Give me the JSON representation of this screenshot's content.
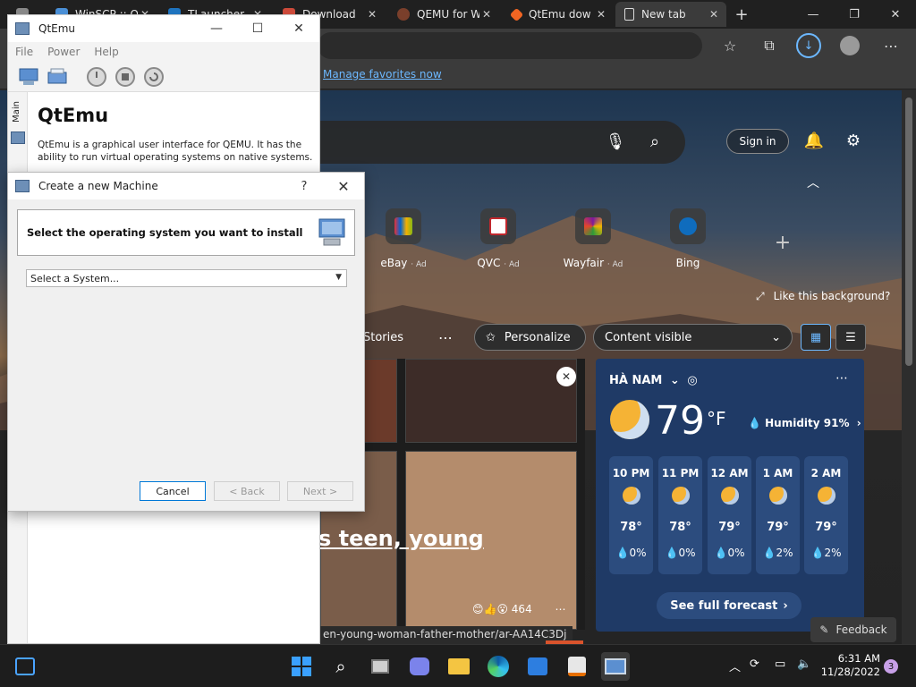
{
  "browser": {
    "tabs": [
      {
        "label": "WinSCP :: O",
        "color": "#4a8fd6"
      },
      {
        "label": "TLauncher",
        "color": "#1e73be"
      },
      {
        "label": "Download",
        "color": "#cc4a3a"
      },
      {
        "label": "QEMU for W",
        "color": "#7a3f2b"
      },
      {
        "label": "QtEmu dow",
        "color": "#f26522"
      },
      {
        "label": "New tab",
        "color": "#dddddd"
      }
    ],
    "favorites_link": "Manage favorites now",
    "sign_in": "Sign in",
    "quick_links": [
      {
        "name": "eBay",
        "ad": "· Ad",
        "color": "#e53238"
      },
      {
        "name": "QVC",
        "ad": "· Ad",
        "color": "#ffffff"
      },
      {
        "name": "Wayfair",
        "ad": "· Ad",
        "color": "#7b189f"
      },
      {
        "name": "Bing",
        "ad": "",
        "color": "#0f6cbd"
      }
    ],
    "like_background": "Like this background?",
    "feed": {
      "stories_tab": "Stories",
      "personalize": "Personalize",
      "content_visible": "Content visible"
    },
    "headline": "s teen, young",
    "reactions_count": "464",
    "status_url": "en-young-woman-father-mother/ar-AA14C3Dj",
    "weather": {
      "location": "HÀ NAM",
      "temperature": "79",
      "unit": "°F",
      "humidity": "Humidity 91%",
      "hours": [
        {
          "time": "10 PM",
          "temp": "78°",
          "precip": "0%"
        },
        {
          "time": "11 PM",
          "temp": "78°",
          "precip": "0%"
        },
        {
          "time": "12 AM",
          "temp": "79°",
          "precip": "0%"
        },
        {
          "time": "1 AM",
          "temp": "79°",
          "precip": "2%"
        },
        {
          "time": "2 AM",
          "temp": "79°",
          "precip": "2%"
        }
      ],
      "forecast_button": "See full forecast"
    },
    "feedback": "Feedback"
  },
  "qtemu": {
    "title": "QtEmu",
    "menu": [
      "File",
      "Power",
      "Help"
    ],
    "side_tab": "Main",
    "heading": "QtEmu",
    "description": "QtEmu is a graphical user interface for QEMU. It has the ability to run virtual operating systems on native systems."
  },
  "dialog": {
    "title": "Create a new Machine",
    "help": "?",
    "header": "Select the operating system you want to install",
    "select_placeholder": "Select a System...",
    "cancel": "Cancel",
    "back": "< Back",
    "next": "Next >"
  },
  "taskbar": {
    "time": "6:31 AM",
    "date": "11/28/2022",
    "notifications": "3"
  }
}
